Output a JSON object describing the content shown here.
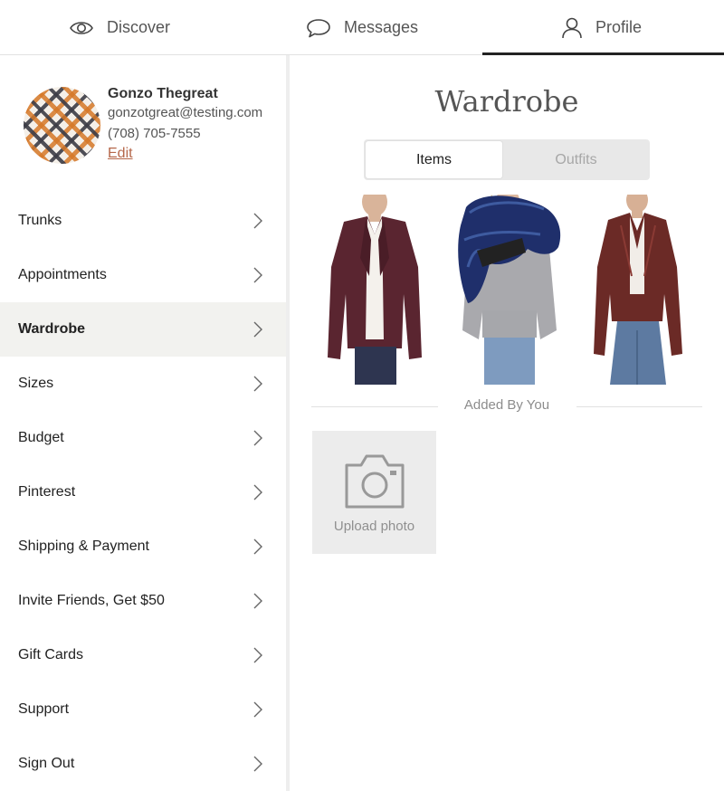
{
  "nav": {
    "tabs": [
      {
        "label": "Discover",
        "icon": "eye-icon"
      },
      {
        "label": "Messages",
        "icon": "speech-bubble-icon"
      },
      {
        "label": "Profile",
        "icon": "person-icon",
        "active": true
      }
    ]
  },
  "profile": {
    "name": "Gonzo Thegreat",
    "email": "gonzotgreat@testing.com",
    "phone": "(708) 705-7555",
    "edit_label": "Edit"
  },
  "menu": {
    "items": [
      {
        "label": "Trunks"
      },
      {
        "label": "Appointments"
      },
      {
        "label": "Wardrobe",
        "active": true
      },
      {
        "label": "Sizes"
      },
      {
        "label": "Budget"
      },
      {
        "label": "Pinterest"
      },
      {
        "label": "Shipping & Payment"
      },
      {
        "label": "Invite Friends, Get $50"
      },
      {
        "label": "Gift Cards"
      },
      {
        "label": "Support"
      },
      {
        "label": "Sign Out"
      }
    ]
  },
  "wardrobe": {
    "title": "Wardrobe",
    "segments": [
      {
        "label": "Items",
        "selected": true
      },
      {
        "label": "Outfits",
        "selected": false
      }
    ],
    "photos": [
      {
        "name": "burgundy-blazer-photo"
      },
      {
        "name": "navy-fur-scarf-photo"
      },
      {
        "name": "burgundy-leather-jacket-photo"
      }
    ],
    "added_by_you_label": "Added By You",
    "upload_label": "Upload photo"
  },
  "colors": {
    "accent_link": "#b5674a",
    "active_row_bg": "#f2f2ef",
    "blazer": "#5a2530",
    "scarf": "#1f2f6b",
    "leather": "#6b2a26"
  }
}
